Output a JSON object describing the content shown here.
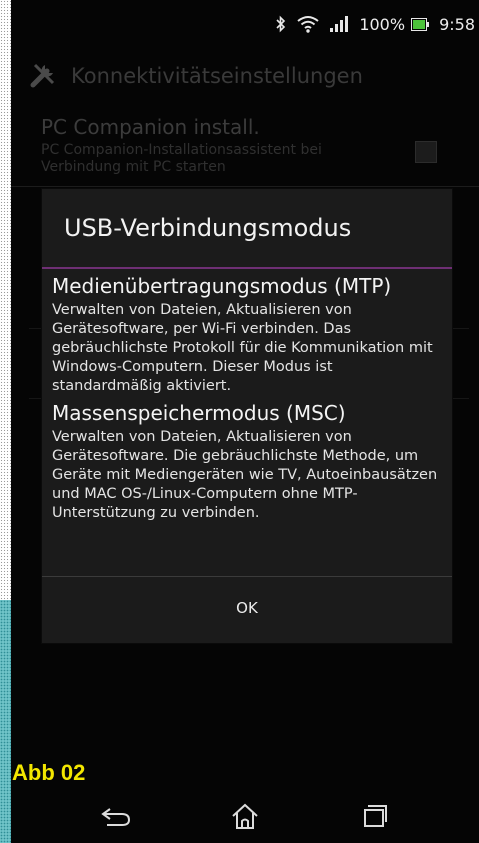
{
  "status_bar": {
    "battery_percent": "100%",
    "time": "9:58",
    "icons": [
      "bluetooth-icon",
      "wifi-icon",
      "signal-icon",
      "battery-icon"
    ]
  },
  "action_bar": {
    "title": "Konnektivitätseinstellungen",
    "icon": "tools-icon"
  },
  "background_settings": {
    "items": [
      {
        "title": "PC Companion install.",
        "subtitle": "PC Companion-Installationsassistent bei Verbindung mit PC starten",
        "checked": false
      }
    ]
  },
  "dialog": {
    "title": "USB-Verbindungsmodus",
    "options": [
      {
        "title": "Medienübertragungsmodus (MTP)",
        "description": "Verwalten von Dateien, Aktualisieren von Gerätesoftware, per Wi-Fi verbinden. Das gebräuchlichste Protokoll für die Kommunikation mit Windows-Computern. Dieser Modus ist standardmäßig aktiviert."
      },
      {
        "title": "Massenspeichermodus (MSC)",
        "description": "Verwalten von Dateien, Aktualisieren von Gerätesoftware. Die gebräuchlichste Methode, um Geräte mit Mediengeräten wie TV, Autoeinbausätzen und MAC OS-/Linux-Computern ohne MTP-Unterstützung zu verbinden."
      }
    ],
    "ok_label": "OK"
  },
  "caption": "Abb 02",
  "nav_bar": {
    "buttons": [
      "back-icon",
      "home-icon",
      "recent-apps-icon"
    ]
  },
  "colors": {
    "accent": "#6e2f74",
    "caption": "#f3e600",
    "dialog_bg": "#1b1b1b"
  }
}
